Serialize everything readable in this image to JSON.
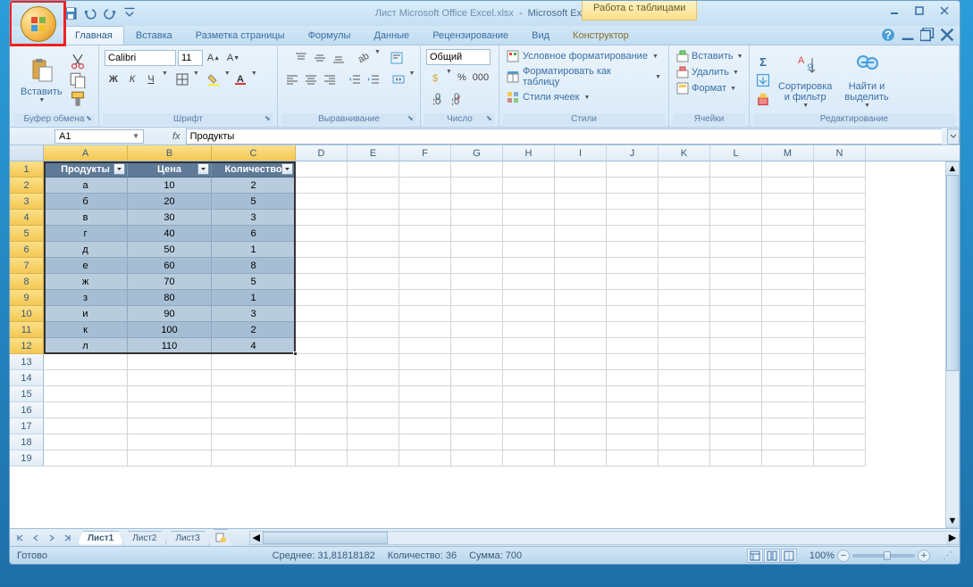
{
  "title": {
    "doc": "Лист Microsoft Office Excel.xlsx",
    "app": "Microsoft Excel"
  },
  "context_tab": "Работа с таблицами",
  "tabs": [
    "Главная",
    "Вставка",
    "Разметка страницы",
    "Формулы",
    "Данные",
    "Рецензирование",
    "Вид",
    "Конструктор"
  ],
  "ribbon": {
    "clipboard": {
      "label": "Буфер обмена",
      "paste": "Вставить"
    },
    "font": {
      "label": "Шрифт",
      "name": "Calibri",
      "size": "11",
      "buttons": {
        "bold": "Ж",
        "italic": "К",
        "underline": "Ч"
      }
    },
    "align": {
      "label": "Выравнивание"
    },
    "number": {
      "label": "Число",
      "format": "Общий"
    },
    "styles": {
      "label": "Стили",
      "cond": "Условное форматирование",
      "table": "Форматировать как таблицу",
      "cell": "Стили ячеек"
    },
    "cells": {
      "label": "Ячейки",
      "insert": "Вставить",
      "delete": "Удалить",
      "format": "Формат"
    },
    "editing": {
      "label": "Редактирование",
      "sort": "Сортировка\nи фильтр",
      "find": "Найти и\nвыделить"
    }
  },
  "namebox": "A1",
  "formula": "Продукты",
  "table": {
    "headers": [
      "Продукты",
      "Цена",
      "Количество"
    ],
    "rows": [
      [
        "а",
        "10",
        "2"
      ],
      [
        "б",
        "20",
        "5"
      ],
      [
        "в",
        "30",
        "3"
      ],
      [
        "г",
        "40",
        "6"
      ],
      [
        "д",
        "50",
        "1"
      ],
      [
        "е",
        "60",
        "8"
      ],
      [
        "ж",
        "70",
        "5"
      ],
      [
        "з",
        "80",
        "1"
      ],
      [
        "и",
        "90",
        "3"
      ],
      [
        "к",
        "100",
        "2"
      ],
      [
        "л",
        "110",
        "4"
      ]
    ]
  },
  "columns": [
    "A",
    "B",
    "C",
    "D",
    "E",
    "F",
    "G",
    "H",
    "I",
    "J",
    "K",
    "L",
    "M",
    "N"
  ],
  "sheets": [
    "Лист1",
    "Лист2",
    "Лист3"
  ],
  "status": {
    "ready": "Готово",
    "avg": "Среднее: 31,81818182",
    "count": "Количество: 36",
    "sum": "Сумма: 700",
    "zoom": "100%"
  }
}
